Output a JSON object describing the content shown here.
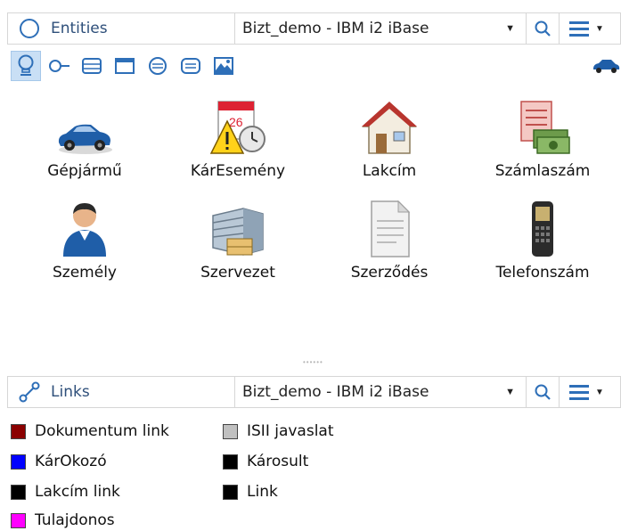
{
  "entities_panel": {
    "title": "Entities",
    "database": "Bizt_demo - IBM i2 iBase",
    "entities": [
      {
        "label": "Gépjármű",
        "icon": "car-icon"
      },
      {
        "label": "KárEsemény",
        "icon": "incident-calendar-warning-icon"
      },
      {
        "label": "Lakcím",
        "icon": "house-icon"
      },
      {
        "label": "Számlaszám",
        "icon": "bank-account-money-icon"
      },
      {
        "label": "Személy",
        "icon": "person-icon"
      },
      {
        "label": "Szervezet",
        "icon": "organization-building-icon"
      },
      {
        "label": "Szerződés",
        "icon": "document-icon"
      },
      {
        "label": "Telefonszám",
        "icon": "mobile-phone-icon"
      }
    ],
    "type_toolbar": [
      {
        "icon": "bulb-icon",
        "active": true
      },
      {
        "icon": "link-end-icon",
        "active": false
      },
      {
        "icon": "frame-icon",
        "active": false
      },
      {
        "icon": "box-icon",
        "active": false
      },
      {
        "icon": "circle-icon",
        "active": false
      },
      {
        "icon": "rounded-box-icon",
        "active": false
      },
      {
        "icon": "picture-icon",
        "active": false
      },
      {
        "icon": "car-icon",
        "active": false
      }
    ]
  },
  "links_panel": {
    "title": "Links",
    "database": "Bizt_demo - IBM i2 iBase",
    "legend": [
      {
        "label": "Dokumentum link",
        "color": "#8b0000"
      },
      {
        "label": "KárOkozó",
        "color": "#0000ff"
      },
      {
        "label": "Lakcím link",
        "color": "#000000"
      },
      {
        "label": "Tulajdonos",
        "color": "#ff00ff"
      },
      {
        "label": "ISII javaslat",
        "color": "#c0c0c0"
      },
      {
        "label": "Károsult",
        "color": "#000000"
      },
      {
        "label": "Link",
        "color": "#000000"
      }
    ]
  },
  "colors": {
    "accent": "#2e6fb8",
    "header_border": "#d6d6d6",
    "active_tool": "#c9dff5"
  }
}
